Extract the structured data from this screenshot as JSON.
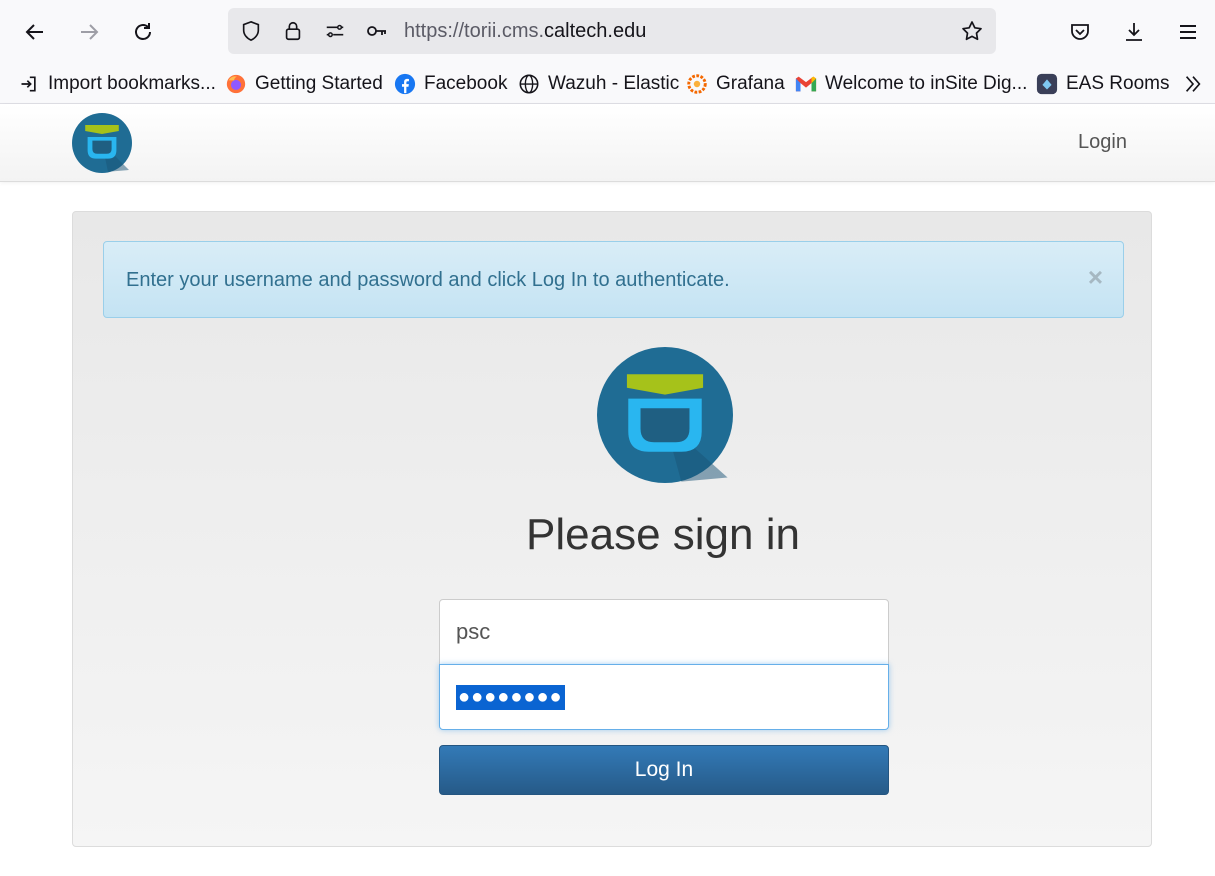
{
  "browser": {
    "url_prefix": "https://torii.cms.",
    "url_host": "caltech.edu",
    "bookmarks": [
      {
        "label": "Import bookmarks...",
        "icon": "import-icon"
      },
      {
        "label": "Getting Started",
        "icon": "firefox-icon"
      },
      {
        "label": "Facebook",
        "icon": "facebook-icon"
      },
      {
        "label": "Wazuh - Elastic",
        "icon": "globe-icon"
      },
      {
        "label": "Grafana",
        "icon": "grafana-icon"
      },
      {
        "label": "Welcome to inSite Dig...",
        "icon": "gmail-icon"
      },
      {
        "label": "EAS Rooms",
        "icon": "eas-rooms-icon"
      }
    ]
  },
  "site": {
    "nav_login": "Login",
    "alert_text": "Enter your username and password and click Log In to authenticate.",
    "alert_close": "×",
    "title": "Please sign in",
    "username_value": "psc",
    "password_mask": "●●●●●●●●",
    "login_button": "Log In"
  },
  "colors": {
    "logo_bg": "#1f6c94",
    "logo_green": "#a6c21a",
    "logo_cyan": "#29b6f0",
    "button_primary": "#2f6fa8",
    "alert_bg": "#d9edf7"
  }
}
